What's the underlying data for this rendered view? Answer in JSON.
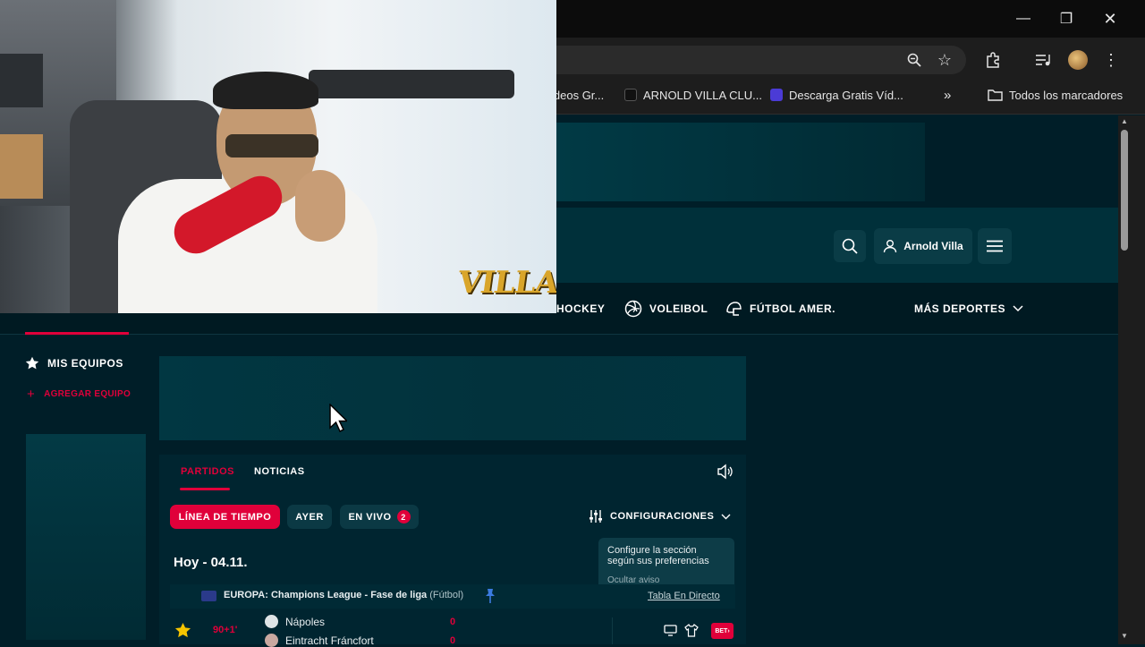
{
  "browser": {
    "bookmarks": [
      {
        "label": "ideos Gr...",
        "icon": "page-icon"
      },
      {
        "label": "ARNOLD VILLA CLU...",
        "icon": "tiktok-icon"
      },
      {
        "label": "Descarga Gratis Víd...",
        "icon": "play-icon"
      }
    ],
    "all_bookmarks_label": "Todos los marcadores"
  },
  "header": {
    "user_name": "Arnold Villa"
  },
  "sports_nav": {
    "items": [
      {
        "label": "HOCKEY",
        "icon": "hockey-icon"
      },
      {
        "label": "VOLEIBOL",
        "icon": "volleyball-icon"
      },
      {
        "label": "FÚTBOL AMER.",
        "icon": "american-football-icon"
      }
    ],
    "more_label": "MÁS DEPORTES"
  },
  "sidebar": {
    "my_teams_label": "MIS EQUIPOS",
    "add_team_label": "AGREGAR EQUIPO"
  },
  "matches": {
    "tabs": [
      {
        "label": "PARTIDOS",
        "active": true
      },
      {
        "label": "NOTICIAS",
        "active": false
      }
    ],
    "filters": {
      "timeline_label": "LÍNEA DE TIEMPO",
      "yesterday_label": "AYER",
      "live_label": "EN VIVO",
      "live_count": "2"
    },
    "config_label": "CONFIGURACIONES",
    "tooltip": {
      "text": "Configure la sección según sus preferencias",
      "hide_label": "Ocultar aviso"
    },
    "date_heading": "Hoy - 04.11.",
    "league": {
      "name": "EUROPA: Champions League - Fase de liga",
      "sport": "(Fútbol)",
      "live_table_label": "Tabla En Directo"
    },
    "match": {
      "minute": "90+1'",
      "home": "Nápoles",
      "away": "Eintracht Fráncfort",
      "home_score": "0",
      "away_score": "0",
      "bet_label": "BET"
    }
  },
  "webcam": {
    "logo_text": "VILLA"
  },
  "colors": {
    "accent": "#e0003a",
    "background": "#001e28",
    "header": "#00303a"
  }
}
